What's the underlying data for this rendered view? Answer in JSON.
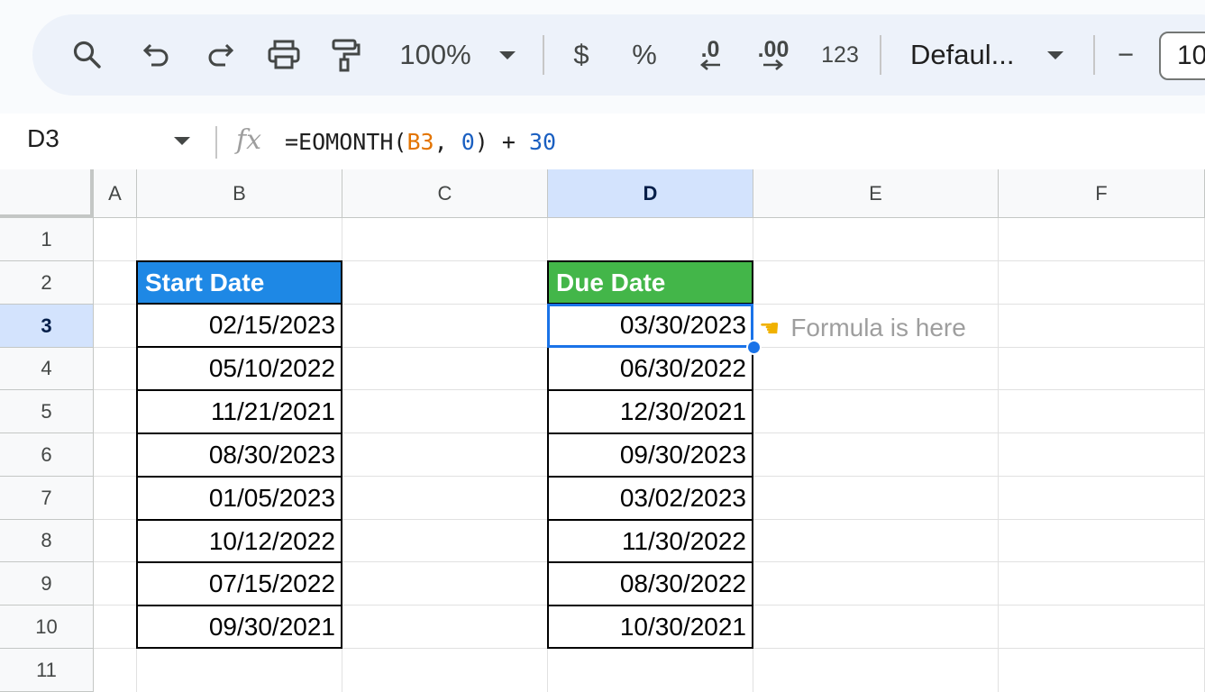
{
  "toolbar": {
    "zoom": "100%",
    "currency": "$",
    "percent": "%",
    "decrease_decimal": ".0",
    "increase_decimal": ".00",
    "number_format": "123",
    "font_family": "Defaul...",
    "font_size_minus": "−",
    "font_size": "10"
  },
  "formula_bar": {
    "name_box": "D3",
    "fx": "fx",
    "formula_prefix": "=EOMONTH(",
    "formula_ref": "B3",
    "formula_sep": ", ",
    "formula_arg": "0",
    "formula_mid": ") + ",
    "formula_num": "30"
  },
  "columns": [
    "A",
    "B",
    "C",
    "D",
    "E",
    "F"
  ],
  "rows": [
    "1",
    "2",
    "3",
    "4",
    "5",
    "6",
    "7",
    "8",
    "9",
    "10",
    "11"
  ],
  "table_start": {
    "header": "Start Date",
    "values": [
      "02/15/2023",
      "05/10/2022",
      "11/21/2021",
      "08/30/2023",
      "01/05/2023",
      "10/12/2022",
      "07/15/2022",
      "09/30/2021"
    ]
  },
  "table_due": {
    "header": "Due Date",
    "values": [
      "03/30/2023",
      "06/30/2022",
      "12/30/2021",
      "09/30/2023",
      "03/02/2023",
      "11/30/2022",
      "08/30/2022",
      "10/30/2021"
    ]
  },
  "note": {
    "icon": "pointing-left-hand-icon",
    "text": "Formula is here"
  },
  "colors": {
    "start_header": "#1e88e5",
    "due_header": "#43b649",
    "selection": "#1a73e8"
  }
}
